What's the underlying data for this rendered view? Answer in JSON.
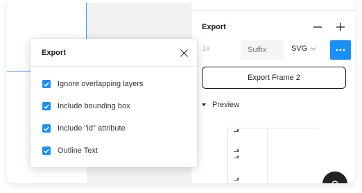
{
  "panel": {
    "title": "Export",
    "scale": "1x",
    "suffix_placeholder": "Suffix",
    "format": "SVG",
    "export_button": "Export Frame 2",
    "preview_label": "Preview"
  },
  "popover": {
    "title": "Export",
    "options": [
      {
        "label": "Ignore overlapping layers",
        "checked": true
      },
      {
        "label": "Include bounding box",
        "checked": true
      },
      {
        "label": "Include \"id\" attribute",
        "checked": true
      },
      {
        "label": "Outline Text",
        "checked": true
      }
    ]
  },
  "colors": {
    "accent": "#1890f5",
    "selection_guide": "#3d9bf0",
    "text": "#1e1e1e",
    "muted_text": "#b3b3b3"
  }
}
